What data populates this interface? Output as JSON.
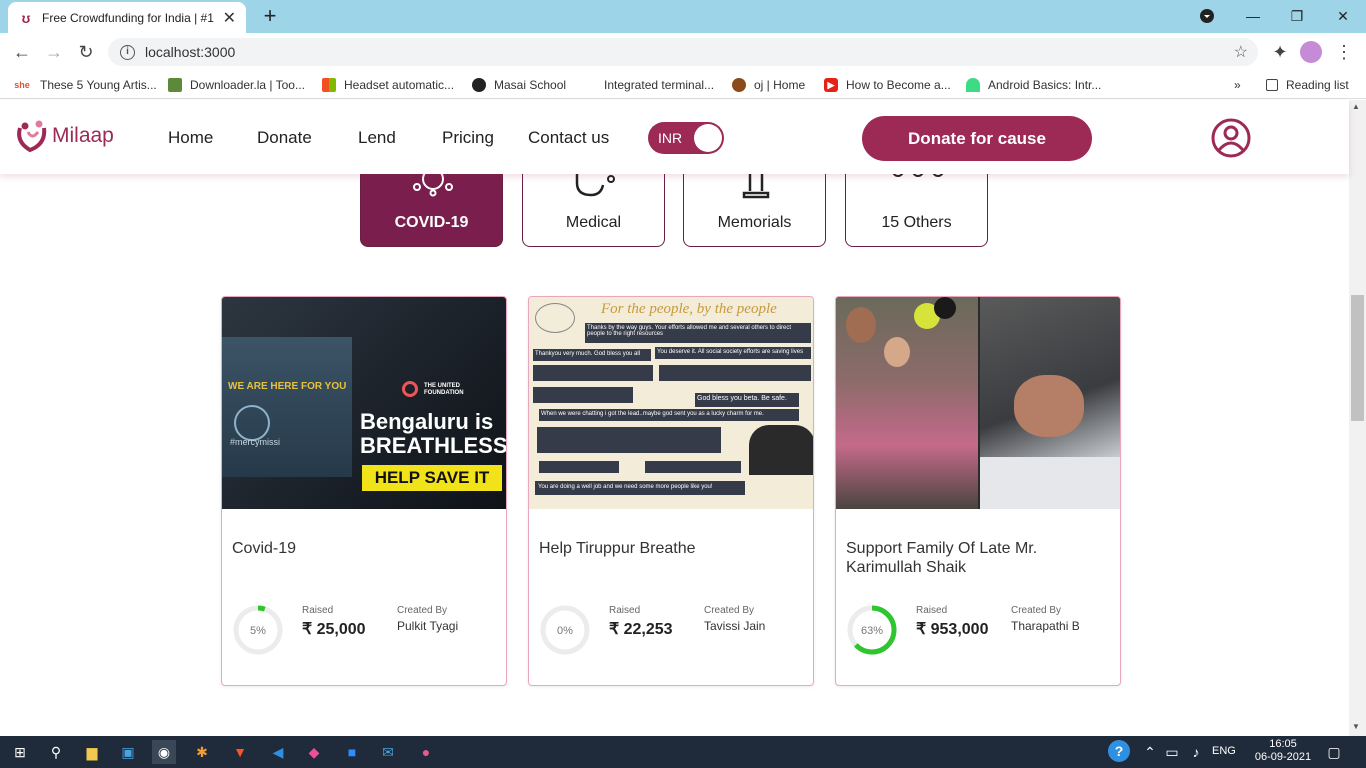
{
  "browser": {
    "tab_title": "Free Crowdfunding for India | #1",
    "url": "localhost:3000",
    "bookmarks": [
      "These 5 Young Artis...",
      "Downloader.la | Too...",
      "Headset automatic...",
      "Masai School",
      "Integrated terminal...",
      "oj | Home",
      "How to Become a...",
      "Android Basics: Intr..."
    ],
    "reading_list": "Reading list"
  },
  "site": {
    "brand": "Milaap",
    "nav": [
      "Home",
      "Donate",
      "Lend",
      "Pricing",
      "Contact us"
    ],
    "currency_toggle": "INR",
    "cta": "Donate for cause",
    "accent_color": "#9c2a55"
  },
  "categories": [
    {
      "label": "COVID-19",
      "active": true
    },
    {
      "label": "Medical",
      "active": false
    },
    {
      "label": "Memorials",
      "active": false
    },
    {
      "label": "15 Others",
      "active": false
    }
  ],
  "cards": [
    {
      "title": "Covid-19",
      "percent": "5%",
      "progress": 0.05,
      "raised_label": "Raised",
      "raised": "₹ 25,000",
      "created_label": "Created By",
      "creator": "Pulkit Tyagi",
      "image_text": {
        "badge": "WE ARE HERE FOR YOU",
        "org": "THE UNITED FOUNDATION",
        "line1": "Bengaluru is",
        "line2": "BREATHLESS",
        "cta": "HELP SAVE IT",
        "handle": "#mercymissi"
      }
    },
    {
      "title": "Help Tiruppur Breathe",
      "percent": "0%",
      "progress": 0.0,
      "raised_label": "Raised",
      "raised": "₹ 22,253",
      "created_label": "Created By",
      "creator": "Tavissi Jain",
      "image_text": {
        "headline": "For the people, by the people",
        "msg1": "Thanks by the way guys. Your efforts allowed me and several others to direct people to the right resources",
        "msg2": "Thankyou very much. God bless you all",
        "msg3": "You deserve it. All social society efforts are saving lives",
        "msg4": "When we were chatting i got the lead..maybe god sent you as a lucky charm for me.",
        "msg5": "God bless you beta. Be safe.",
        "msg6": "You are doing a well job and we need some more people like you!"
      }
    },
    {
      "title": "Support Family Of Late Mr. Karimullah Shaik",
      "percent": "63%",
      "progress": 0.63,
      "raised_label": "Raised",
      "raised": "₹ 953,000",
      "created_label": "Created By",
      "creator": "Tharapathi B"
    }
  ],
  "taskbar": {
    "lang": "ENG",
    "time": "16:05",
    "date": "06-09-2021"
  }
}
